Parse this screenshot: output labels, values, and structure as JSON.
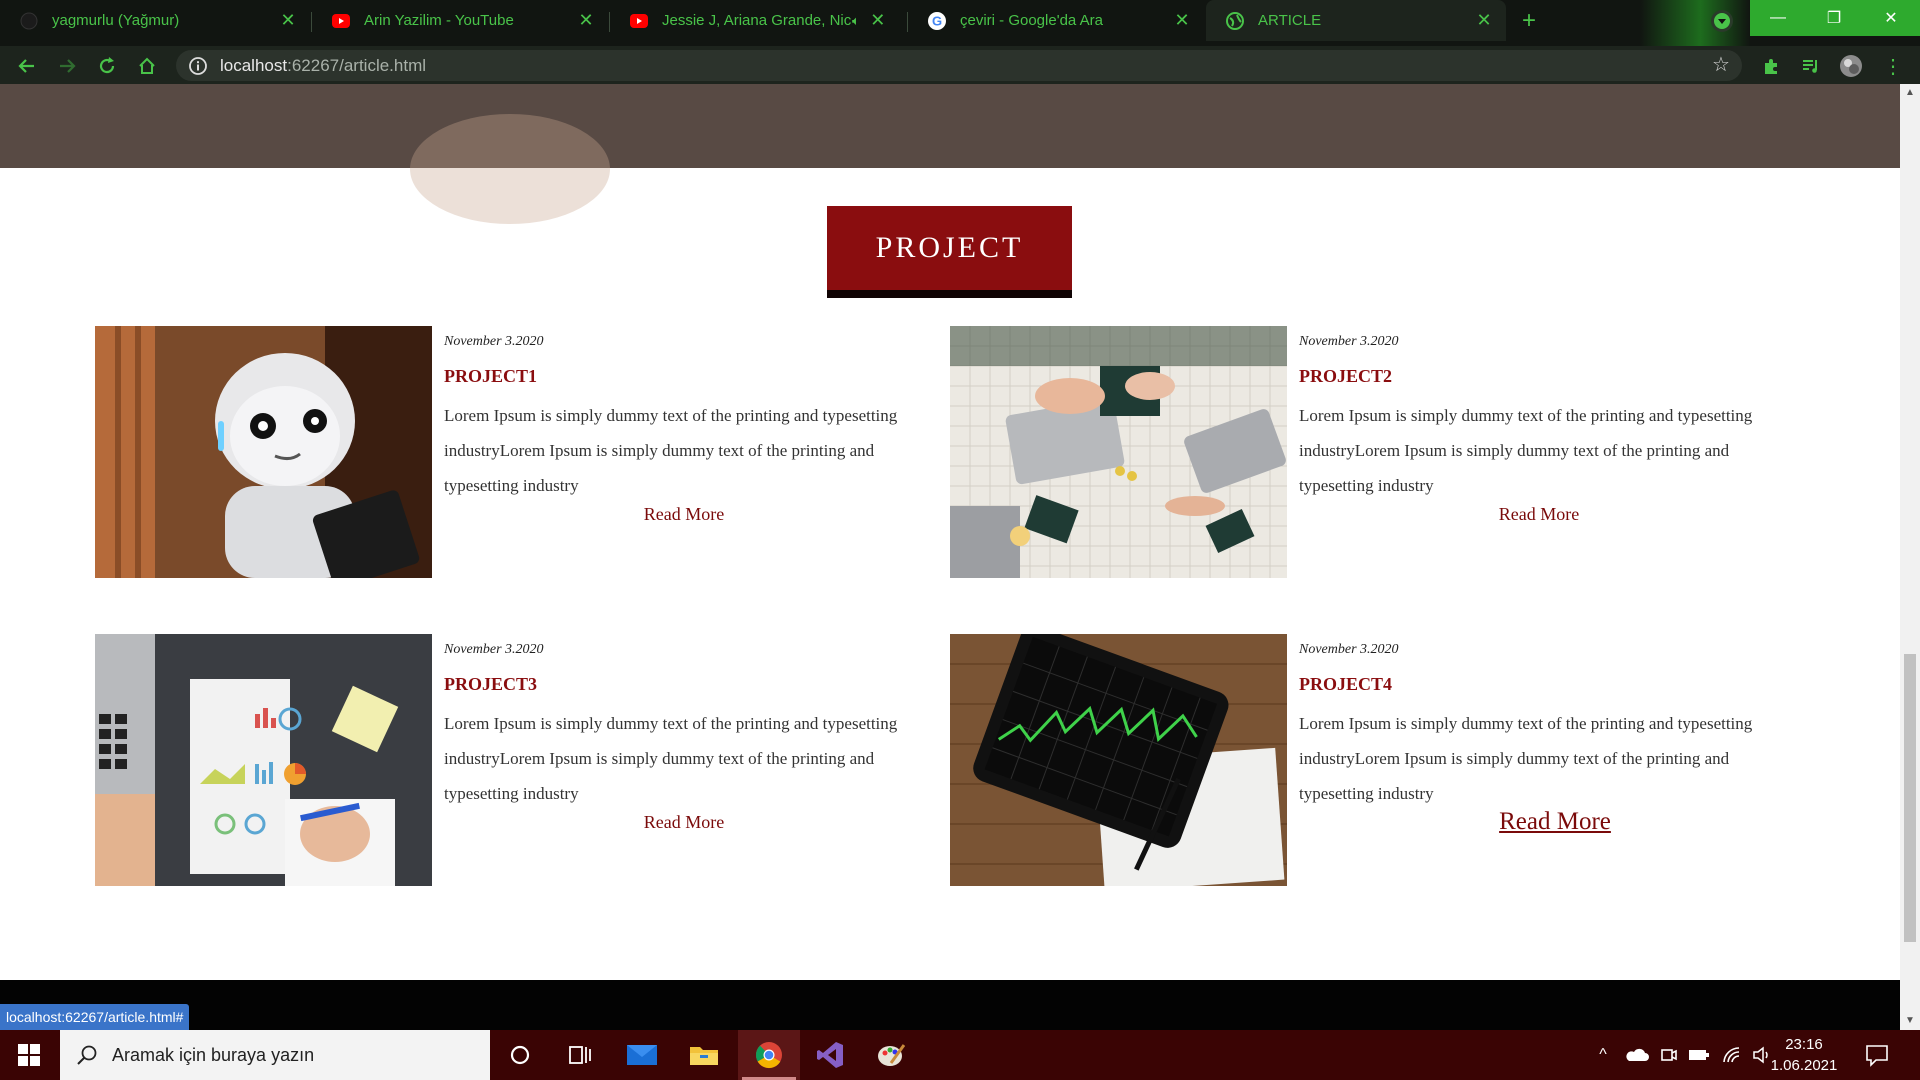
{
  "browser": {
    "tabs": [
      {
        "title": "yagmurlu (Yağmur)",
        "icon": "github-icon"
      },
      {
        "title": "Arin Yazilim - YouTube",
        "icon": "youtube-icon"
      },
      {
        "title": "Jessie J, Ariana Grande, Nicki Minaj - Bang Bang",
        "icon": "youtube-icon",
        "audio": "speaker-icon"
      },
      {
        "title": "çeviri - Google'da Ara",
        "icon": "google-icon"
      },
      {
        "title": "ARTICLE",
        "icon": "globe-icon",
        "active": true
      }
    ],
    "url_host": "localhost",
    "url_rest": ":62267/article.html",
    "status_url": "localhost:62267/article.html#",
    "accent": "#49c349"
  },
  "page": {
    "section_heading": "PROJECT",
    "brand_color": "#8a0d0f",
    "projects": [
      {
        "date": "November 3.2020",
        "title": "PROJECT1",
        "description": "Lorem Ipsum is simply dummy text of the printing and typesetting industryLorem Ipsum is simply dummy text of the printing and typesetting industry",
        "read_more": "Read More",
        "image": "robot-photo"
      },
      {
        "date": "November 3.2020",
        "title": "PROJECT2",
        "description": "Lorem Ipsum is simply dummy text of the printing and typesetting industryLorem Ipsum is simply dummy text of the printing and typesetting industry",
        "read_more": "Read More",
        "image": "meeting-laptops-photo"
      },
      {
        "date": "November 3.2020",
        "title": "PROJECT3",
        "description": "Lorem Ipsum is simply dummy text of the printing and typesetting industryLorem Ipsum is simply dummy text of the printing and typesetting industry",
        "read_more": "Read More",
        "image": "charts-report-photo"
      },
      {
        "date": "November 3.2020",
        "title": "PROJECT4",
        "description": "Lorem Ipsum is simply dummy text of the printing and typesetting industryLorem Ipsum is simply dummy text of the printing and typesetting industry",
        "read_more": "Read More",
        "image": "tablet-stock-chart-photo",
        "hovered": true
      }
    ]
  },
  "taskbar": {
    "search_placeholder": "Aramak için buraya yazın",
    "time": "23:16",
    "date": "1.06.2021",
    "apps": [
      "cortana-icon",
      "task-view-icon",
      "mail-icon",
      "file-explorer-icon",
      "chrome-icon",
      "visual-studio-icon",
      "paint-icon"
    ]
  }
}
